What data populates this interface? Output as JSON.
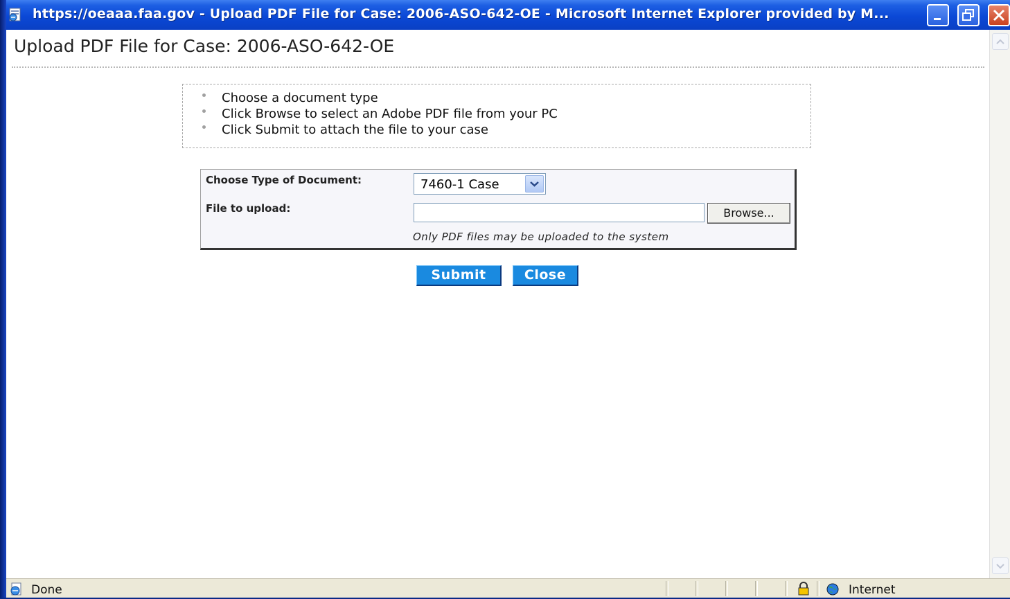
{
  "window": {
    "title": "https://oeaaa.faa.gov - Upload PDF File for Case: 2006-ASO-642-OE - Microsoft Internet Explorer provided by M...",
    "buttons": [
      "minimize-icon",
      "restore-icon",
      "close-icon"
    ]
  },
  "page": {
    "title": "Upload PDF File for Case: 2006-ASO-642-OE",
    "instructions": [
      "Choose a document type",
      "Click Browse to select an Adobe PDF file from your PC",
      "Click Submit to attach the file to your case"
    ]
  },
  "form": {
    "doc_type_label": "Choose Type of Document:",
    "doc_type_value": "7460-1 Case",
    "file_label": "File to upload:",
    "file_value": "",
    "browse_label": "Browse...",
    "note": "Only PDF files may be uploaded to the system"
  },
  "actions": {
    "submit_label": "Submit",
    "close_label": "Close"
  },
  "status": {
    "text": "Done",
    "zone": "Internet"
  },
  "colors": {
    "titlebar": "#0b48d6",
    "button_blue": "#1a8ae0",
    "status_bar": "#ece9d8"
  }
}
